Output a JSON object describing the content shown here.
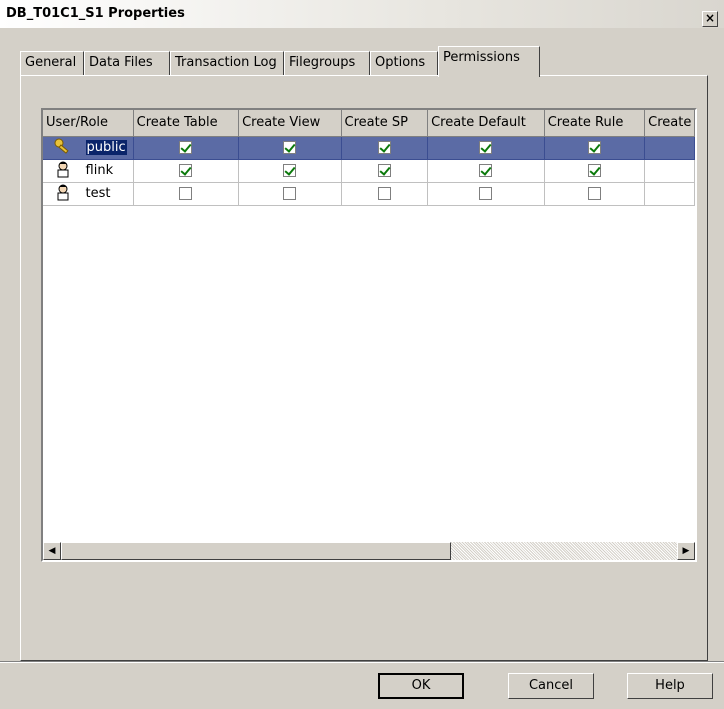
{
  "window": {
    "title": "DB_T01C1_S1 Properties",
    "close_glyph": "×"
  },
  "tabs": [
    {
      "label": "General"
    },
    {
      "label": "Data Files"
    },
    {
      "label": "Transaction Log"
    },
    {
      "label": "Filegroups"
    },
    {
      "label": "Options"
    },
    {
      "label": "Permissions",
      "active": true
    }
  ],
  "grid": {
    "columns": [
      "User/Role",
      "Create Table",
      "Create View",
      "Create SP",
      "Create Default",
      "Create Rule",
      "Create"
    ],
    "rows": [
      {
        "icon": "key-icon",
        "name": "public",
        "selected": true,
        "perms": [
          true,
          true,
          true,
          true,
          true
        ]
      },
      {
        "icon": "user-icon",
        "name": "flink",
        "selected": false,
        "perms": [
          true,
          true,
          true,
          true,
          true
        ]
      },
      {
        "icon": "user-icon",
        "name": "test",
        "selected": false,
        "perms": [
          false,
          false,
          false,
          false,
          false
        ]
      }
    ]
  },
  "scrollbar": {
    "left_arrow": "◀",
    "right_arrow": "▶"
  },
  "buttons": {
    "ok": "OK",
    "cancel": "Cancel",
    "help": "Help"
  }
}
